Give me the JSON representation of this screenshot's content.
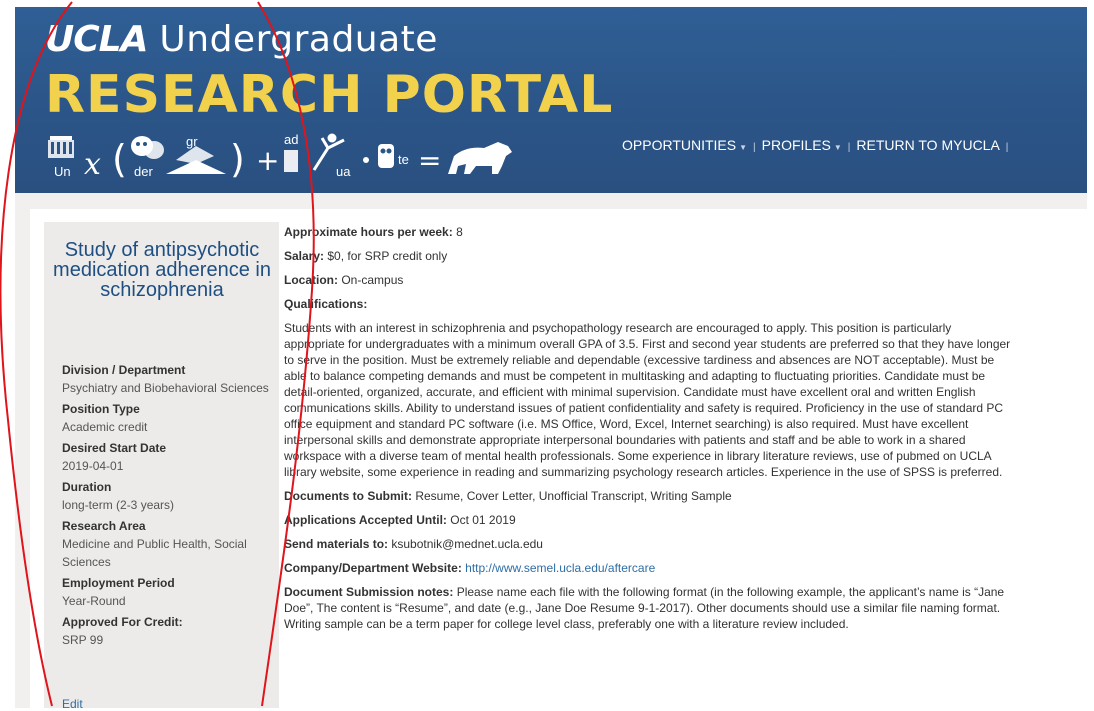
{
  "header": {
    "logo_ucla": "UCLA",
    "logo_undergrad": "Undergraduate",
    "logo_portal": "RESEARCH PORTAL",
    "rebus": {
      "t1": "Un",
      "t2": "x",
      "t3": "der",
      "t4": "gr",
      "t5": "ad",
      "t6": "ua",
      "t7": "te"
    }
  },
  "nav": {
    "items": [
      {
        "label": "OPPORTUNITIES",
        "icon": "caret-down-icon"
      },
      {
        "label": "PROFILES",
        "icon": "caret-down-icon"
      },
      {
        "label": "RETURN TO MYUCLA"
      }
    ]
  },
  "sidebar": {
    "title": "Study of antipsychotic medication adherence in schizophrenia",
    "fields": [
      {
        "label": "Division / Department",
        "value": "Psychiatry and Biobehavioral Sciences"
      },
      {
        "label": "Position Type",
        "value": "Academic credit"
      },
      {
        "label": "Desired Start Date",
        "value": "2019-04-01"
      },
      {
        "label": "Duration",
        "value": "long-term (2-3 years)"
      },
      {
        "label": "Research Area",
        "value": "Medicine and Public Health, Social Sciences"
      },
      {
        "label": "Employment Period",
        "value": "Year-Round"
      },
      {
        "label": "Approved For Credit:",
        "value": "SRP 99"
      }
    ],
    "edit_label": "Edit"
  },
  "main": {
    "hours": {
      "label": "Approximate hours per week:",
      "value": "8"
    },
    "salary": {
      "label": "Salary:",
      "value": "$0, for SRP credit only"
    },
    "location": {
      "label": "Location:",
      "value": "On-campus"
    },
    "qualifications_label": "Qualifications:",
    "qualifications_text": "Students with an interest in schizophrenia and psychopathology research are encouraged to apply. This position is particularly appropriate for undergraduates with a minimum overall GPA of 3.5. First and second year students are preferred so that they have longer to serve in the position. Must be extremely reliable and dependable (excessive tardiness and absences are NOT acceptable). Must be able to balance competing demands and must be competent in multitasking and adapting to fluctuating priorities. Candidate must be detail-oriented, organized, accurate, and efficient with minimal supervision. Candidate must have excellent oral and written English communications skills. Ability to understand issues of patient confidentiality and safety is required. Proficiency in the use of standard PC office equipment and standard PC software (i.e. MS Office, Word, Excel, Internet searching) is also required. Must have excellent interpersonal skills and demonstrate appropriate interpersonal boundaries with patients and staff and be able to work in a shared workspace with a diverse team of mental health professionals. Some experience in library literature reviews, use of pubmed on UCLA library website, some experience in reading and summarizing psychology research articles. Experience in the use of SPSS is preferred.",
    "documents": {
      "label": "Documents to Submit:",
      "value": "Resume, Cover Letter, Unofficial Transcript, Writing Sample"
    },
    "accepted": {
      "label": "Applications Accepted Until:",
      "value": "Oct 01 2019"
    },
    "send": {
      "label": "Send materials to:",
      "value": "ksubotnik@mednet.ucla.edu"
    },
    "website": {
      "label": "Company/Department Website:",
      "value": "http://www.semel.ucla.edu/aftercare"
    },
    "notes": {
      "label": "Document Submission notes:",
      "value": "Please name each file with the following format (in the following example, the applicant’s name is “Jane Doe”, The content is “Resume”, and date (e.g., Jane Doe Resume 9-1-2017). Other documents should use a similar file naming format. Writing sample can be a term paper for college level class, preferably one with a literature review included."
    }
  },
  "colors": {
    "header_blue": "#2b5487",
    "portal_gold": "#f2d24c",
    "title_blue": "#1f4f82",
    "link_blue": "#2e6da4",
    "annotation_red": "#e0141b"
  }
}
